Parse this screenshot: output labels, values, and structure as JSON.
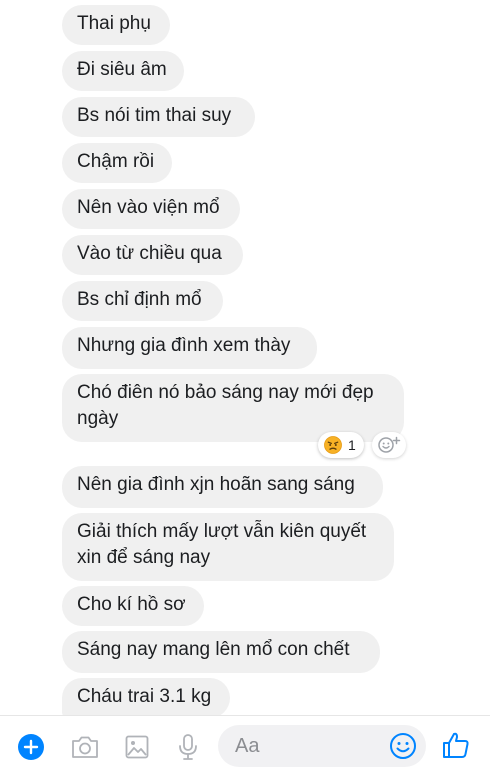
{
  "messages": [
    {
      "text": "Thai phụ"
    },
    {
      "text": "Đi siêu âm"
    },
    {
      "text": "Bs nói tim thai suy"
    },
    {
      "text": "Chậm rồi"
    },
    {
      "text": "Nên vào viện mổ"
    },
    {
      "text": "Vào từ chiều qua"
    },
    {
      "text": "Bs chỉ định mổ"
    },
    {
      "text": "Nhưng gia đình xem thày"
    },
    {
      "text": "Chó điên nó bảo sáng nay mới đẹp ngày"
    },
    {
      "text": "Nên gia đình xjn hoãn sang sáng"
    },
    {
      "text": "Giải thích mấy lượt vẫn kiên quyết xin để sáng nay"
    },
    {
      "text": "Cho kí hồ sơ"
    },
    {
      "text": "Sáng nay mang lên mổ con chết"
    },
    {
      "text": "Cháu trai 3.1 kg"
    }
  ],
  "reaction": {
    "emoji": "angry-face",
    "count": "1",
    "add_icon": "add-reaction-icon"
  },
  "composer": {
    "placeholder": "Aa",
    "icons": [
      "plus-icon",
      "camera-icon",
      "image-icon",
      "microphone-icon",
      "emoji-icon",
      "thumbs-up-icon"
    ]
  },
  "colors": {
    "bubble": "#f0f0f0",
    "accent": "#0084ff",
    "text": "#1c1e21"
  }
}
